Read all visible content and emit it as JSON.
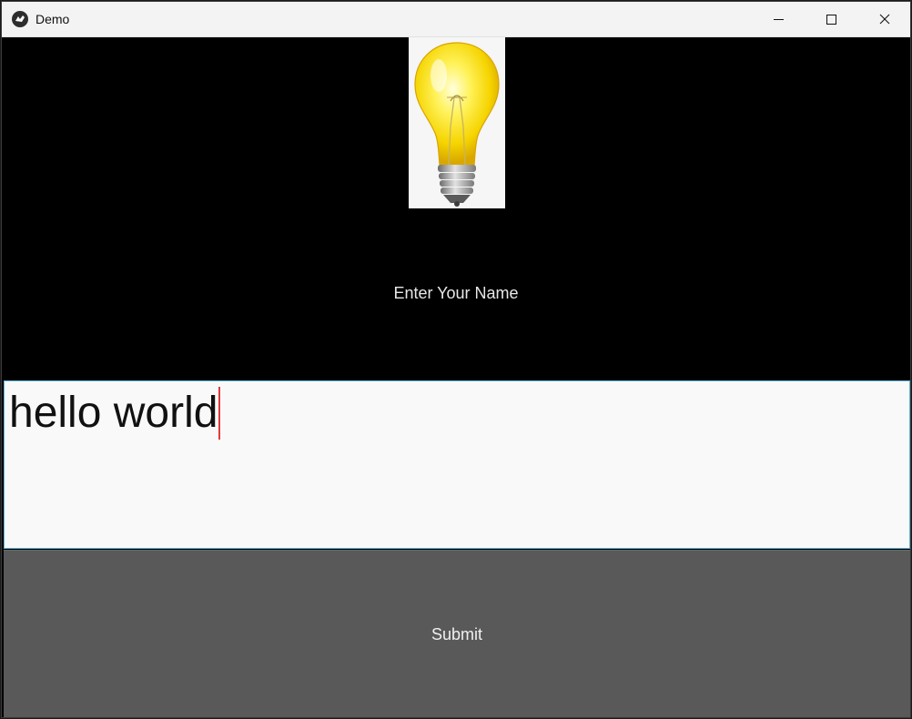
{
  "window": {
    "title": "Demo",
    "app_icon": "kivy-logo-icon",
    "controls": {
      "minimize": "minimize-icon",
      "maximize": "maximize-icon",
      "close": "close-icon"
    }
  },
  "main": {
    "image_icon": "lightbulb-icon",
    "prompt_label": "Enter Your Name",
    "input": {
      "value": "hello world"
    },
    "submit_label": "Submit"
  },
  "colors": {
    "background": "#000000",
    "input_background": "#f9f9f9",
    "input_border": "#5bb6d6",
    "cursor": "#e23b3b",
    "button_background": "#595959",
    "text_light": "#e8e8e8"
  }
}
